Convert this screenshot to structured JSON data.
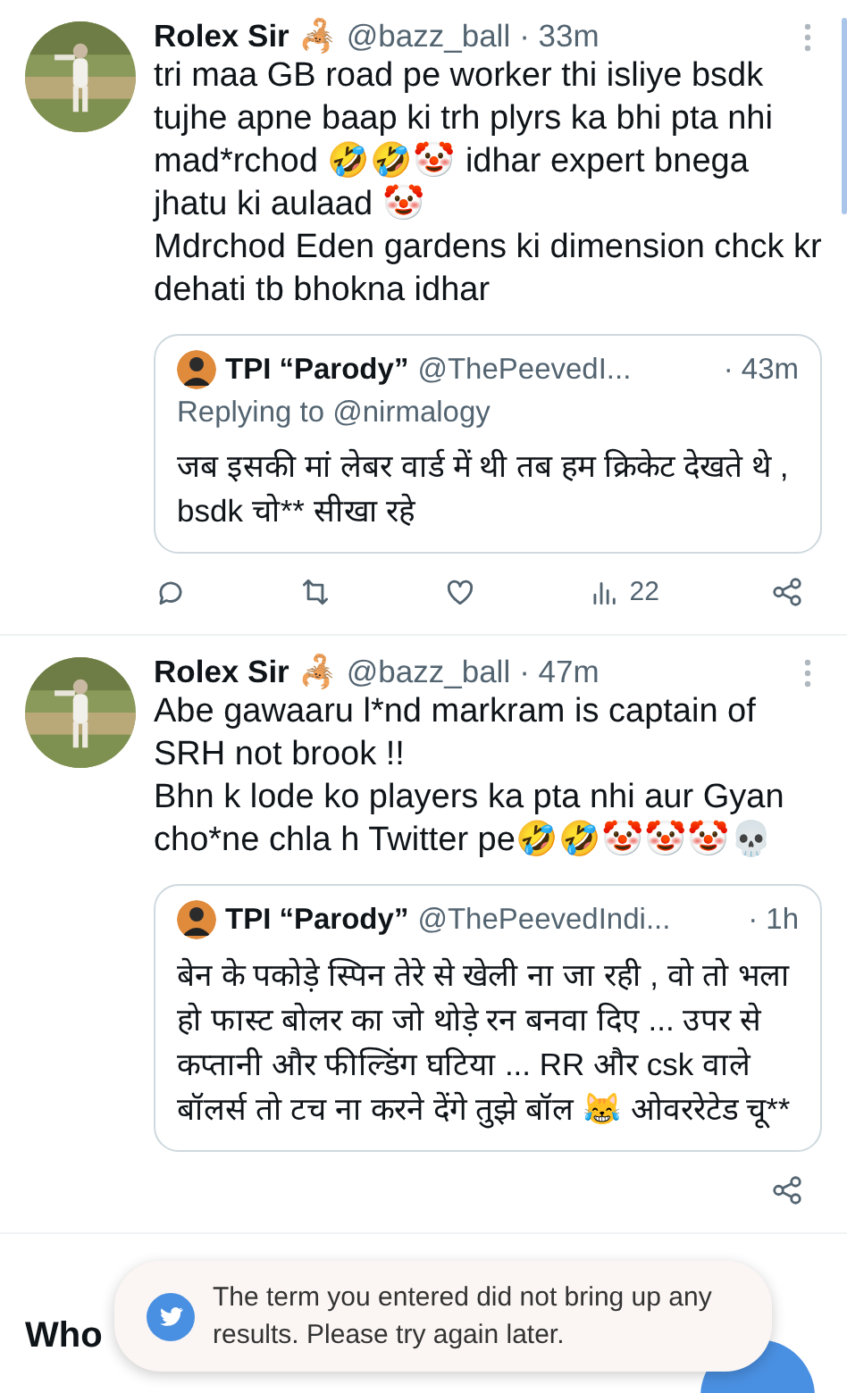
{
  "tweets": [
    {
      "author": "Rolex Sir",
      "badge": "🦂",
      "handle": "@bazz_ball",
      "time": "· 33m",
      "paragraphs": [
        "tri maa GB road pe worker thi isliye bsdk tujhe apne baap ki trh plyrs ka bhi  pta nhi mad*rchod 🤣🤣🤡 idhar expert bnega jhatu ki aulaad 🤡",
        "Mdrchod Eden gardens ki dimension chck kr dehati tb bhokna idhar"
      ],
      "quote": {
        "name": "TPI “Parody”",
        "handle": "@ThePeevedI...",
        "time": "· 43m",
        "replying_to": "Replying to @nirmalogy",
        "text": "जब इसकी मां लेबर वार्ड में थी तब हम क्रिकेट देखते थे , bsdk चो** सीखा रहे"
      },
      "actions": [
        {
          "kind": "reply"
        },
        {
          "kind": "retweet"
        },
        {
          "kind": "like"
        },
        {
          "kind": "views",
          "count": "22"
        },
        {
          "kind": "share"
        }
      ]
    },
    {
      "author": "Rolex Sir",
      "badge": "🦂",
      "handle": "@bazz_ball",
      "time": "· 47m",
      "paragraphs": [
        "Abe gawaaru l*nd markram is captain of SRH not brook !!",
        "Bhn k lode ko players ka pta nhi aur Gyan cho*ne chla h Twitter pe🤣🤣🤡🤡🤡💀"
      ],
      "quote": {
        "name": "TPI “Parody”",
        "handle": "@ThePeevedIndi...",
        "time": "· 1h",
        "text": "बेन के पकोड़े स्पिन तेरे से खेली ना जा रही , वो तो भला हो फास्ट बोलर का जो थोड़े रन बनवा दिए ... उपर से कप्तानी और फील्डिंग घटिया ... RR और csk वाले बॉलर्स तो टच ना करने देंगे तुझे बॉल 😹 ओवररेटेड चू**"
      },
      "actions": [
        {
          "kind": "share"
        }
      ]
    }
  ],
  "section_heading": "Who",
  "toast": {
    "message": "The term you entered did not bring up any results. Please try again later."
  }
}
